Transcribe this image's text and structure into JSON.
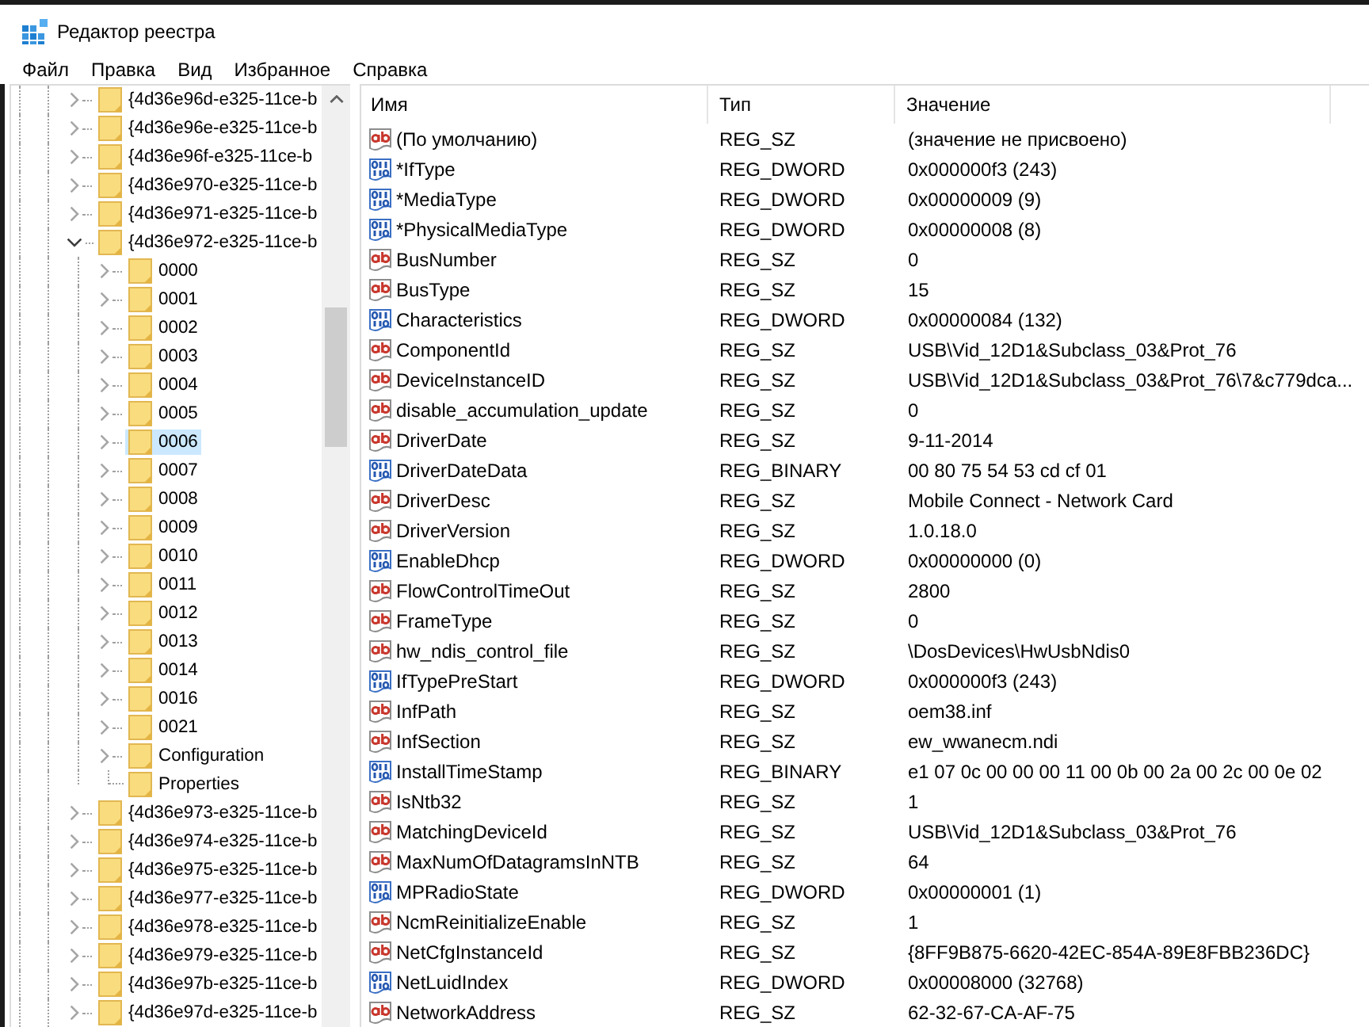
{
  "window": {
    "title": "Редактор реестра"
  },
  "menu": [
    "Файл",
    "Правка",
    "Вид",
    "Избранное",
    "Справка"
  ],
  "tree": {
    "items": [
      {
        "label": "{4d36e96d-e325-11ce-b",
        "expandable": true,
        "expanded": false,
        "selected": false
      },
      {
        "label": "{4d36e96e-e325-11ce-b",
        "expandable": true,
        "expanded": false,
        "selected": false
      },
      {
        "label": "{4d36e96f-e325-11ce-b",
        "expandable": true,
        "expanded": false,
        "selected": false
      },
      {
        "label": "{4d36e970-e325-11ce-b",
        "expandable": true,
        "expanded": false,
        "selected": false
      },
      {
        "label": "{4d36e971-e325-11ce-b",
        "expandable": true,
        "expanded": false,
        "selected": false
      },
      {
        "label": "{4d36e972-e325-11ce-b",
        "expandable": true,
        "expanded": true,
        "selected": false,
        "children": [
          {
            "label": "0000",
            "expandable": true,
            "expanded": false,
            "selected": false
          },
          {
            "label": "0001",
            "expandable": true,
            "expanded": false,
            "selected": false
          },
          {
            "label": "0002",
            "expandable": true,
            "expanded": false,
            "selected": false
          },
          {
            "label": "0003",
            "expandable": true,
            "expanded": false,
            "selected": false
          },
          {
            "label": "0004",
            "expandable": true,
            "expanded": false,
            "selected": false
          },
          {
            "label": "0005",
            "expandable": true,
            "expanded": false,
            "selected": false
          },
          {
            "label": "0006",
            "expandable": true,
            "expanded": false,
            "selected": true
          },
          {
            "label": "0007",
            "expandable": true,
            "expanded": false,
            "selected": false
          },
          {
            "label": "0008",
            "expandable": true,
            "expanded": false,
            "selected": false
          },
          {
            "label": "0009",
            "expandable": true,
            "expanded": false,
            "selected": false
          },
          {
            "label": "0010",
            "expandable": true,
            "expanded": false,
            "selected": false
          },
          {
            "label": "0011",
            "expandable": true,
            "expanded": false,
            "selected": false
          },
          {
            "label": "0012",
            "expandable": true,
            "expanded": false,
            "selected": false
          },
          {
            "label": "0013",
            "expandable": true,
            "expanded": false,
            "selected": false
          },
          {
            "label": "0014",
            "expandable": true,
            "expanded": false,
            "selected": false
          },
          {
            "label": "0016",
            "expandable": true,
            "expanded": false,
            "selected": false
          },
          {
            "label": "0021",
            "expandable": true,
            "expanded": false,
            "selected": false
          },
          {
            "label": "Configuration",
            "expandable": true,
            "expanded": false,
            "selected": false
          },
          {
            "label": "Properties",
            "expandable": false,
            "expanded": false,
            "selected": false
          }
        ]
      },
      {
        "label": "{4d36e973-e325-11ce-b",
        "expandable": true,
        "expanded": false,
        "selected": false
      },
      {
        "label": "{4d36e974-e325-11ce-b",
        "expandable": true,
        "expanded": false,
        "selected": false
      },
      {
        "label": "{4d36e975-e325-11ce-b",
        "expandable": true,
        "expanded": false,
        "selected": false
      },
      {
        "label": "{4d36e977-e325-11ce-b",
        "expandable": true,
        "expanded": false,
        "selected": false
      },
      {
        "label": "{4d36e978-e325-11ce-b",
        "expandable": true,
        "expanded": false,
        "selected": false
      },
      {
        "label": "{4d36e979-e325-11ce-b",
        "expandable": true,
        "expanded": false,
        "selected": false
      },
      {
        "label": "{4d36e97b-e325-11ce-b",
        "expandable": true,
        "expanded": false,
        "selected": false
      },
      {
        "label": "{4d36e97d-e325-11ce-b",
        "expandable": true,
        "expanded": false,
        "selected": false
      }
    ]
  },
  "value_list": {
    "columns": [
      "Имя",
      "Тип",
      "Значение"
    ],
    "rows": [
      {
        "kind": "string",
        "name": "(По умолчанию)",
        "type": "REG_SZ",
        "data": "(значение не присвоено)"
      },
      {
        "kind": "binary",
        "name": "*IfType",
        "type": "REG_DWORD",
        "data": "0x000000f3 (243)"
      },
      {
        "kind": "binary",
        "name": "*MediaType",
        "type": "REG_DWORD",
        "data": "0x00000009 (9)"
      },
      {
        "kind": "binary",
        "name": "*PhysicalMediaType",
        "type": "REG_DWORD",
        "data": "0x00000008 (8)"
      },
      {
        "kind": "string",
        "name": "BusNumber",
        "type": "REG_SZ",
        "data": "0"
      },
      {
        "kind": "string",
        "name": "BusType",
        "type": "REG_SZ",
        "data": "15"
      },
      {
        "kind": "binary",
        "name": "Characteristics",
        "type": "REG_DWORD",
        "data": "0x00000084 (132)"
      },
      {
        "kind": "string",
        "name": "ComponentId",
        "type": "REG_SZ",
        "data": "USB\\Vid_12D1&Subclass_03&Prot_76"
      },
      {
        "kind": "string",
        "name": "DeviceInstanceID",
        "type": "REG_SZ",
        "data": "USB\\Vid_12D1&Subclass_03&Prot_76\\7&c779dca..."
      },
      {
        "kind": "string",
        "name": "disable_accumulation_update",
        "type": "REG_SZ",
        "data": "0"
      },
      {
        "kind": "string",
        "name": "DriverDate",
        "type": "REG_SZ",
        "data": "9-11-2014"
      },
      {
        "kind": "binary",
        "name": "DriverDateData",
        "type": "REG_BINARY",
        "data": "00 80 75 54 53 cd cf 01"
      },
      {
        "kind": "string",
        "name": "DriverDesc",
        "type": "REG_SZ",
        "data": "Mobile Connect - Network Card"
      },
      {
        "kind": "string",
        "name": "DriverVersion",
        "type": "REG_SZ",
        "data": "1.0.18.0"
      },
      {
        "kind": "binary",
        "name": "EnableDhcp",
        "type": "REG_DWORD",
        "data": "0x00000000 (0)"
      },
      {
        "kind": "string",
        "name": "FlowControlTimeOut",
        "type": "REG_SZ",
        "data": "2800"
      },
      {
        "kind": "string",
        "name": "FrameType",
        "type": "REG_SZ",
        "data": "0"
      },
      {
        "kind": "string",
        "name": "hw_ndis_control_file",
        "type": "REG_SZ",
        "data": "\\DosDevices\\HwUsbNdis0"
      },
      {
        "kind": "binary",
        "name": "IfTypePreStart",
        "type": "REG_DWORD",
        "data": "0x000000f3 (243)"
      },
      {
        "kind": "string",
        "name": "InfPath",
        "type": "REG_SZ",
        "data": "oem38.inf"
      },
      {
        "kind": "string",
        "name": "InfSection",
        "type": "REG_SZ",
        "data": "ew_wwanecm.ndi"
      },
      {
        "kind": "binary",
        "name": "InstallTimeStamp",
        "type": "REG_BINARY",
        "data": "e1 07 0c 00 00 00 11 00 0b 00 2a 00 2c 00 0e 02"
      },
      {
        "kind": "string",
        "name": "IsNtb32",
        "type": "REG_SZ",
        "data": "1"
      },
      {
        "kind": "string",
        "name": "MatchingDeviceId",
        "type": "REG_SZ",
        "data": "USB\\Vid_12D1&Subclass_03&Prot_76"
      },
      {
        "kind": "string",
        "name": "MaxNumOfDatagramsInNTB",
        "type": "REG_SZ",
        "data": "64"
      },
      {
        "kind": "binary",
        "name": "MPRadioState",
        "type": "REG_DWORD",
        "data": "0x00000001 (1)"
      },
      {
        "kind": "string",
        "name": "NcmReinitializeEnable",
        "type": "REG_SZ",
        "data": "1"
      },
      {
        "kind": "string",
        "name": "NetCfgInstanceId",
        "type": "REG_SZ",
        "data": "{8FF9B875-6620-42EC-854A-89E8FBB236DC}"
      },
      {
        "kind": "binary",
        "name": "NetLuidIndex",
        "type": "REG_DWORD",
        "data": "0x00008000 (32768)"
      },
      {
        "kind": "string",
        "name": "NetworkAddress",
        "type": "REG_SZ",
        "data": "62-32-67-CA-AF-75"
      }
    ]
  }
}
